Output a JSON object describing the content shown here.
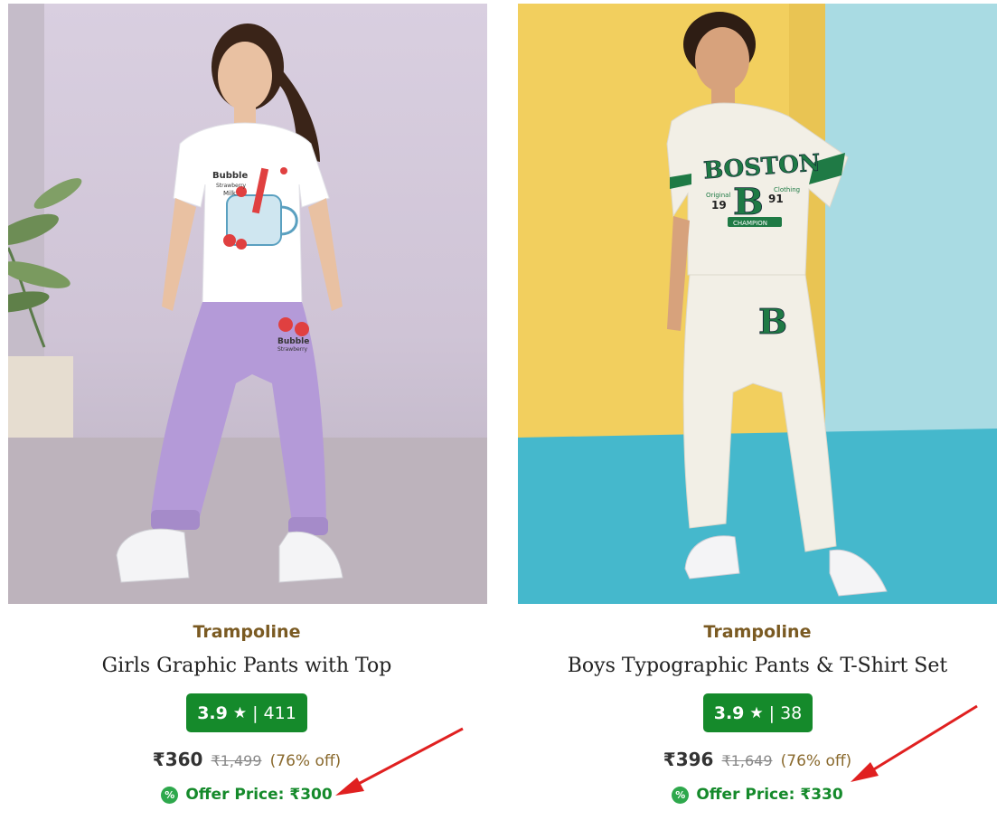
{
  "products": [
    {
      "brand": "Trampoline",
      "title": "Girls Graphic Pants with Top",
      "rating": "3.9",
      "rating_icon": "star-icon",
      "reviews": "411",
      "price": "₹360",
      "mrp": "₹1,499",
      "discount": "(76% off)",
      "offer_label": "Offer Price: ₹300",
      "offer_icon": "percent-badge-icon",
      "image": {
        "subject": "girl-in-white-tee-and-lilac-joggers",
        "tee_print": {
          "line1": "Bubble",
          "line2": "Strawberry",
          "line3": "Milk"
        },
        "pants_print": {
          "line1": "Bubble",
          "line2": "Strawberry"
        }
      }
    },
    {
      "brand": "Trampoline",
      "title": "Boys Typographic Pants & T-Shirt Set",
      "rating": "3.9",
      "rating_icon": "star-icon",
      "reviews": "38",
      "price": "₹396",
      "mrp": "₹1,649",
      "discount": "(76% off)",
      "offer_label": "Offer Price: ₹330",
      "offer_icon": "percent-badge-icon",
      "image": {
        "subject": "boy-in-cream-boston-tee-and-joggers",
        "tee_print": {
          "main": "BOSTON",
          "letter": "B",
          "left": "Original",
          "right": "Clothing",
          "num_left": "19",
          "num_right": "91",
          "band": "CHAMPION"
        },
        "pants_print": {
          "letter": "B"
        }
      }
    }
  ],
  "colors": {
    "rating_badge": "#158a2b",
    "offer_text": "#158a2b",
    "brand_text": "#7a5a22",
    "annotation_arrow": "#e02020"
  }
}
